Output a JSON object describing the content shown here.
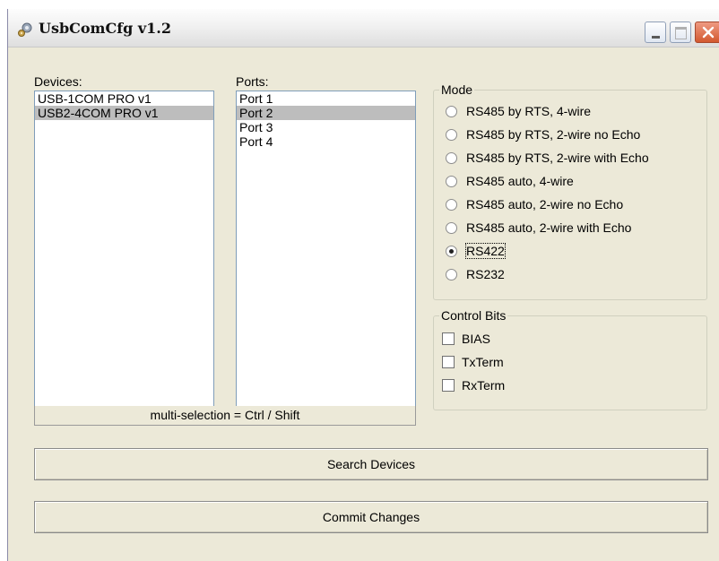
{
  "window": {
    "title": "UsbComCfg v1.2"
  },
  "devices": {
    "label": "Devices:",
    "items": [
      "USB-1COM PRO v1",
      "USB2-4COM PRO v1"
    ],
    "selected_index": 1
  },
  "ports": {
    "label": "Ports:",
    "items": [
      "Port 1",
      "Port 2",
      "Port 3",
      "Port 4"
    ],
    "selected_index": 1
  },
  "hint": "multi-selection = Ctrl / Shift",
  "mode": {
    "legend": "Mode",
    "options": [
      "RS485 by RTS, 4-wire",
      "RS485 by RTS, 2-wire no Echo",
      "RS485 by RTS, 2-wire with Echo",
      "RS485 auto, 4-wire",
      "RS485 auto, 2-wire no Echo",
      "RS485 auto, 2-wire with Echo",
      "RS422",
      "RS232"
    ],
    "selected": "RS422"
  },
  "control_bits": {
    "legend": "Control Bits",
    "options": [
      "BIAS",
      "TxTerm",
      "RxTerm"
    ],
    "checked": []
  },
  "buttons": {
    "search": "Search Devices",
    "commit": "Commit Changes"
  },
  "colors": {
    "dialog_bg": "#ece9d8",
    "list_selection": "#bdbdbd",
    "close_button": "#d3582f"
  }
}
